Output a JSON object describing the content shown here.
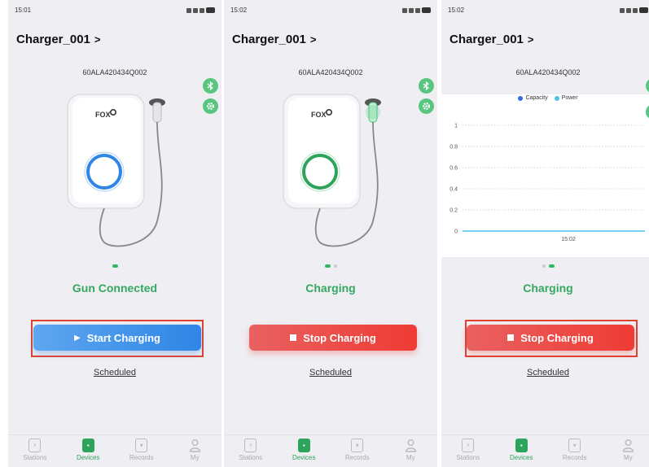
{
  "screens": [
    {
      "time": "15:01",
      "device_name": "Charger_001",
      "title_arrow": ">",
      "serial": "60ALA420434Q002",
      "brand": "FOX",
      "ring_color": "#2f86e6",
      "status": "Gun Connected",
      "action_label": "Start Charging",
      "action_icon": "play-icon",
      "scheduled": "Scheduled",
      "active_page": 1
    },
    {
      "time": "15:02",
      "device_name": "Charger_001",
      "title_arrow": ">",
      "serial": "60ALA420434Q002",
      "brand": "FOX",
      "ring_color": "#2ea35b",
      "status": "Charging",
      "action_label": "Stop Charging",
      "action_icon": "stop-icon",
      "scheduled": "Scheduled",
      "active_page": 1
    },
    {
      "time": "15:02",
      "device_name": "Charger_001",
      "title_arrow": ">",
      "serial": "60ALA420434Q002",
      "status": "Charging",
      "action_label": "Stop Charging",
      "action_icon": "stop-icon",
      "scheduled": "Scheduled",
      "active_page": 2
    }
  ],
  "tabs": [
    {
      "label": "Stations",
      "icon": "station-icon"
    },
    {
      "label": "Devices",
      "icon": "device-icon",
      "active": true
    },
    {
      "label": "Records",
      "icon": "records-icon"
    },
    {
      "label": "My",
      "icon": "user-icon"
    }
  ],
  "chart_data": {
    "type": "line",
    "legend": [
      "Capacity",
      "Power"
    ],
    "legend_colors": [
      "#2f6ee6",
      "#4cc3ee"
    ],
    "y_ticks": [
      "1",
      "0.8",
      "0.6",
      "0.4",
      "0.2",
      "0"
    ],
    "x_ticks": [
      "15:02"
    ],
    "series": [
      {
        "name": "Power",
        "x": [
          "15:02"
        ],
        "values": [
          0
        ]
      }
    ],
    "ylim": [
      0,
      1
    ],
    "grid": true,
    "legend_position": "top-center"
  },
  "colors": {
    "accent_green": "#2ea35b",
    "start_blue": "#2f86e6",
    "stop_red": "#ef3b34",
    "highlight_red": "#e1412f"
  }
}
